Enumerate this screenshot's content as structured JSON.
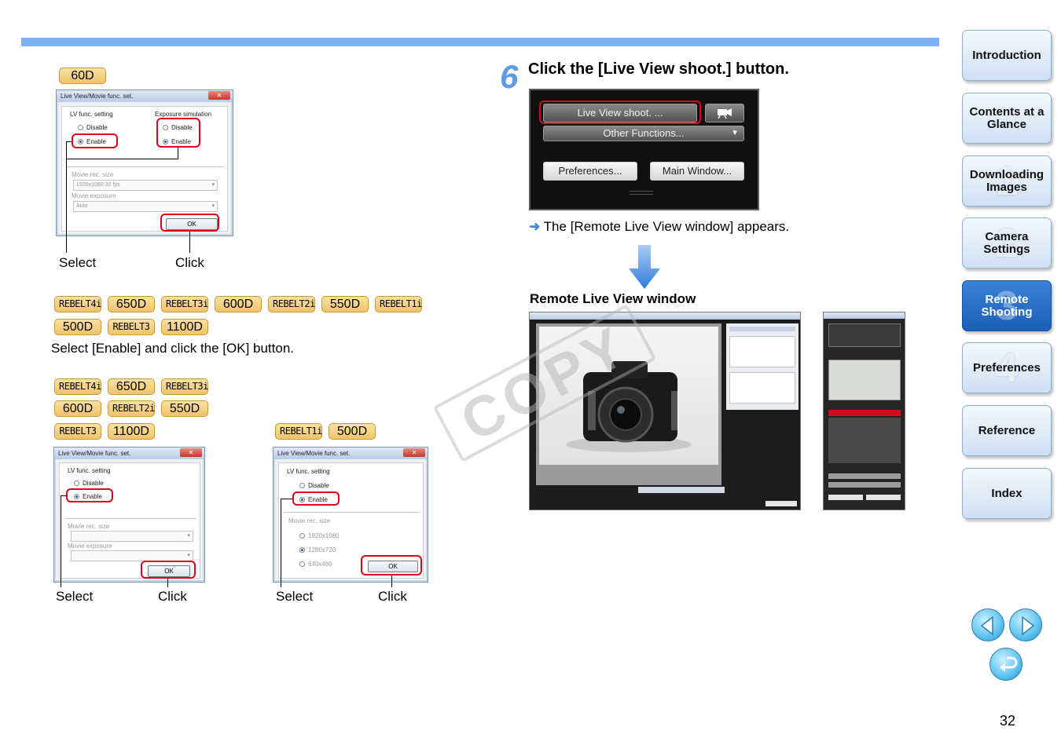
{
  "page": {
    "number": "32",
    "watermark": "COPY"
  },
  "section_60d": {
    "badge": "60D",
    "dialog": {
      "title": "Live View/Movie func. set.",
      "group1_label": "LV func. setting",
      "group2_label": "Exposure simulation",
      "disable": "Disable",
      "enable": "Enable",
      "movie_size_label": "Movie rec. size",
      "movie_size_value": "1920x1080  30 fps",
      "movie_exposure_label": "Movie exposure",
      "movie_exposure_value": "Auto",
      "ok": "OK",
      "close": "✕"
    },
    "select_label": "Select",
    "click_label": "Click"
  },
  "section_multi": {
    "badges_row1": [
      "REBELT4i",
      "650D",
      "REBELT3i",
      "600D",
      "REBELT2i",
      "550D",
      "REBELT1i"
    ],
    "badges_row2": [
      "500D",
      "REBELT3",
      "1100D"
    ],
    "instruction": "Select [Enable] and click the [OK] button."
  },
  "section_left": {
    "badges_row1": [
      "REBELT4i",
      "650D",
      "REBELT3i"
    ],
    "badges_row2": [
      "600D",
      "REBELT2i",
      "550D"
    ],
    "badges_row3": [
      "REBELT3",
      "1100D"
    ],
    "dialog": {
      "title": "Live View/Movie func. set.",
      "group_label": "LV func. setting",
      "disable": "Disable",
      "enable": "Enable",
      "movie_size_label": "Movie rec. size",
      "movie_exposure_label": "Movie exposure",
      "ok": "OK",
      "close": "✕"
    },
    "select_label": "Select",
    "click_label": "Click"
  },
  "section_right": {
    "badges": [
      "REBELT1i",
      "500D"
    ],
    "dialog": {
      "title": "Live View/Movie func. set.",
      "group_label": "LV func. setting",
      "disable": "Disable",
      "enable": "Enable",
      "movie_size_label": "Movie rec. size",
      "size_options": [
        "1920x1080",
        "1280x720",
        "640x480"
      ],
      "ok": "OK",
      "close": "✕"
    },
    "select_label": "Select",
    "click_label": "Click"
  },
  "step6": {
    "number": "6",
    "title": "Click the [Live View shoot.] button.",
    "panel": {
      "live_view_button": "Live View shoot. ...",
      "other_functions_button": "Other Functions...",
      "preferences_button": "Preferences...",
      "main_window_button": "Main Window..."
    },
    "result_arrow": "➜",
    "result_text": "The [Remote Live View window] appears.",
    "window_caption": "Remote Live View window"
  },
  "nav": {
    "items": [
      {
        "label": "Introduction",
        "num": ""
      },
      {
        "label": "Contents at a Glance",
        "num": ""
      },
      {
        "label": "Downloading Images",
        "num": "1"
      },
      {
        "label": "Camera Settings",
        "num": "2"
      },
      {
        "label": "Remote Shooting",
        "num": "3"
      },
      {
        "label": "Preferences",
        "num": "4"
      },
      {
        "label": "Reference",
        "num": ""
      },
      {
        "label": "Index",
        "num": ""
      }
    ]
  },
  "colors": {
    "accent_blue": "#7fb1f0",
    "highlight_red": "#e0001a",
    "nav_active": "#1b5fb8",
    "badge_fill": "#efc46a"
  }
}
